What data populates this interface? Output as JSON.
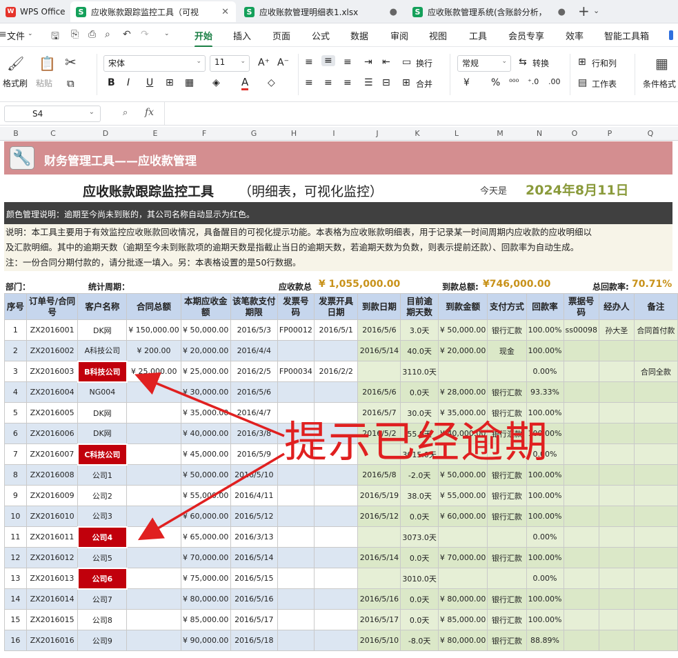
{
  "tabs": [
    {
      "label": "WPS Office",
      "icon": "wps-logo-icon"
    },
    {
      "label": "应收账款跟踪监控工具（可视",
      "icon": "spreadsheet-icon"
    },
    {
      "label": "应收账款管理明细表1.xlsx",
      "icon": "spreadsheet-icon"
    },
    {
      "label": "应收账款管理系统(含账龄分析，",
      "icon": "spreadsheet-icon"
    }
  ],
  "menu": {
    "file": "文件",
    "items": [
      "开始",
      "插入",
      "页面",
      "公式",
      "数据",
      "审阅",
      "视图",
      "工具",
      "会员专享",
      "效率",
      "智能工具箱"
    ],
    "active": "开始"
  },
  "ribbon": {
    "format_painter": "格式刷",
    "paste": "粘贴",
    "font_name": "宋体",
    "font_size": "11",
    "bold": "B",
    "italic": "I",
    "underline": "U",
    "wrap": "换行",
    "merge": "合并",
    "number_format": "常规",
    "convert": "转换",
    "rows_cols": "行和列",
    "worksheet": "工作表",
    "cond_format": "条件格式",
    "yen": "¥",
    "percent": "%"
  },
  "formula": {
    "cell_ref": "S4",
    "fx": "fx"
  },
  "columns": [
    "B",
    "C",
    "D",
    "E",
    "F",
    "G",
    "H",
    "I",
    "J",
    "K",
    "L",
    "M",
    "N",
    "O",
    "P",
    "Q"
  ],
  "sheet": {
    "banner": "财务管理工具——应收款管理",
    "main_title": "应收账款跟踪监控工具",
    "sub_title": "（明细表，可视化监控）",
    "today_label": "今天是",
    "today_value": "2024年8月11日",
    "color_note": "颜色管理说明：逾期至今尚未到账的，其公司名称自动显示为红色。",
    "note1": "说明：本工具主要用于有效监控应收账款回收情况，具备醒目的可视化提示功能。本表格为应收账款明细表，用于记录某一时间周期内应收款的应收明细以",
    "note2": "及汇款明细。其中的逾期天数（逾期至今未到账款项的逾期天数是指截止当日的逾期天数，若逾期天数为负数，则表示提前还款）、回款率为自动生成。",
    "note3": "注：一份合同分期付款的，请分批逐一填入。另：本表格设置的是50行数据。",
    "dept_label": "部门：",
    "period_label": "统计周期：",
    "receivable_label": "应收款总",
    "receivable_value": "¥ 1,055,000.00",
    "received_label": "到款总额:",
    "received_value": "¥746,000.00",
    "rate_label": "总回款率:",
    "rate_value": "70.71%"
  },
  "table": {
    "headers": [
      "序号",
      "订单号/合同号",
      "客户名称",
      "合同总额",
      "本期应收金额",
      "该笔款支付期限",
      "发票号码",
      "发票开具日期",
      "到款日期",
      "目前逾期天数",
      "到款金额",
      "支付方式",
      "回款率",
      "票据号码",
      "经办人",
      "备注"
    ],
    "rows": [
      [
        "1",
        "ZX2016001",
        "DK网",
        "¥ 150,000.00",
        "¥ 50,000.00",
        "2016/5/3",
        "FP00012",
        "2016/5/1",
        "2016/5/6",
        "3.0天",
        "¥ 50,000.00",
        "银行汇款",
        "100.00%",
        "ss00098",
        "孙大圣",
        "合同首付款"
      ],
      [
        "2",
        "ZX2016002",
        "A科技公司",
        "¥ 200.00",
        "¥ 20,000.00",
        "2016/4/4",
        "",
        "",
        "2016/5/14",
        "40.0天",
        "¥ 20,000.00",
        "现金",
        "100.00%",
        "",
        "",
        ""
      ],
      [
        "3",
        "ZX2016003",
        "B科技公司",
        "¥ 25,000.00",
        "¥ 25,000.00",
        "2016/2/5",
        "FP00034",
        "2016/2/2",
        "",
        "3110.0天",
        "",
        "",
        "0.00%",
        "",
        "",
        "合同全款"
      ],
      [
        "4",
        "ZX2016004",
        "NG004",
        "",
        "¥ 30,000.00",
        "2016/5/6",
        "",
        "",
        "2016/5/6",
        "0.0天",
        "¥ 28,000.00",
        "银行汇款",
        "93.33%",
        "",
        "",
        ""
      ],
      [
        "5",
        "ZX2016005",
        "DK网",
        "",
        "¥ 35,000.00",
        "2016/4/7",
        "",
        "",
        "2016/5/7",
        "30.0天",
        "¥ 35,000.00",
        "银行汇款",
        "100.00%",
        "",
        "",
        ""
      ],
      [
        "6",
        "ZX2016006",
        "DK网",
        "",
        "¥ 40,000.00",
        "2016/3/8",
        "",
        "",
        "2016/5/2",
        "55.0天",
        "¥ 40,000.00",
        "银行汇款",
        "100.00%",
        "",
        "",
        ""
      ],
      [
        "7",
        "ZX2016007",
        "C科技公司",
        "",
        "¥ 45,000.00",
        "2016/5/9",
        "",
        "",
        "",
        "3015.0天",
        "",
        "",
        "0.00%",
        "",
        "",
        ""
      ],
      [
        "8",
        "ZX2016008",
        "公司1",
        "",
        "¥ 50,000.00",
        "2016/5/10",
        "",
        "",
        "2016/5/8",
        "-2.0天",
        "¥ 50,000.00",
        "银行汇款",
        "100.00%",
        "",
        "",
        ""
      ],
      [
        "9",
        "ZX2016009",
        "公司2",
        "",
        "¥ 55,000.00",
        "2016/4/11",
        "",
        "",
        "2016/5/19",
        "38.0天",
        "¥ 55,000.00",
        "银行汇款",
        "100.00%",
        "",
        "",
        ""
      ],
      [
        "10",
        "ZX2016010",
        "公司3",
        "",
        "¥ 60,000.00",
        "2016/5/12",
        "",
        "",
        "2016/5/12",
        "0.0天",
        "¥ 60,000.00",
        "银行汇款",
        "100.00%",
        "",
        "",
        ""
      ],
      [
        "11",
        "ZX2016011",
        "公司4",
        "",
        "¥ 65,000.00",
        "2016/3/13",
        "",
        "",
        "",
        "3073.0天",
        "",
        "",
        "0.00%",
        "",
        "",
        ""
      ],
      [
        "12",
        "ZX2016012",
        "公司5",
        "",
        "¥ 70,000.00",
        "2016/5/14",
        "",
        "",
        "2016/5/14",
        "0.0天",
        "¥ 70,000.00",
        "银行汇款",
        "100.00%",
        "",
        "",
        ""
      ],
      [
        "13",
        "ZX2016013",
        "公司6",
        "",
        "¥ 75,000.00",
        "2016/5/15",
        "",
        "",
        "",
        "3010.0天",
        "",
        "",
        "0.00%",
        "",
        "",
        ""
      ],
      [
        "14",
        "ZX2016014",
        "公司7",
        "",
        "¥ 80,000.00",
        "2016/5/16",
        "",
        "",
        "2016/5/16",
        "0.0天",
        "¥ 80,000.00",
        "银行汇款",
        "100.00%",
        "",
        "",
        ""
      ],
      [
        "15",
        "ZX2016015",
        "公司8",
        "",
        "¥ 85,000.00",
        "2016/5/17",
        "",
        "",
        "2016/5/17",
        "0.0天",
        "¥ 85,000.00",
        "银行汇款",
        "100.00%",
        "",
        "",
        ""
      ],
      [
        "16",
        "ZX2016016",
        "公司9",
        "",
        "¥ 90,000.00",
        "2016/5/18",
        "",
        "",
        "2016/5/10",
        "-8.0天",
        "¥ 80,000.00",
        "银行汇款",
        "88.89%",
        "",
        "",
        ""
      ]
    ],
    "overdue_rows": [
      3,
      7,
      11,
      13
    ]
  },
  "annotation": {
    "text": "提示已经逾期",
    "color": "#e02020"
  },
  "colors": {
    "banner": "#d48e90",
    "overdue": "#c1000c",
    "header": "#c6d6ed",
    "accent": "#1a7f45"
  }
}
